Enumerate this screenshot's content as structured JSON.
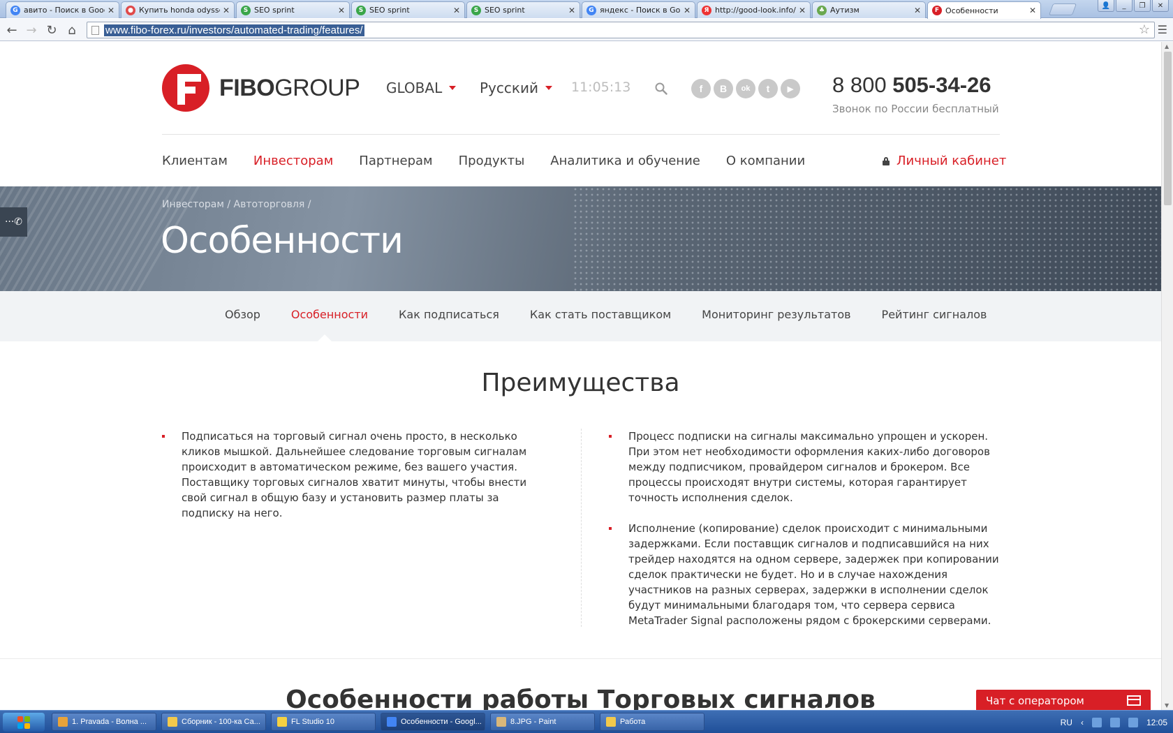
{
  "browser": {
    "tabs": [
      {
        "title": "авито - Поиск в Google",
        "icon": "google-icon",
        "color": "#4285f4",
        "glyph": "G"
      },
      {
        "title": "Купить honda odyssey",
        "icon": "avito-icon",
        "color": "#e04a4a",
        "glyph": "●"
      },
      {
        "title": "SEO sprint",
        "icon": "seosprint-icon",
        "color": "#3aa64a",
        "glyph": "S"
      },
      {
        "title": "SEO sprint",
        "icon": "seosprint-icon",
        "color": "#3aa64a",
        "glyph": "S"
      },
      {
        "title": "SEO sprint",
        "icon": "seosprint-icon",
        "color": "#3aa64a",
        "glyph": "S"
      },
      {
        "title": "яндекс - Поиск в Google",
        "icon": "google-icon",
        "color": "#4285f4",
        "glyph": "G"
      },
      {
        "title": "http://good-look.info/",
        "icon": "yandex-icon",
        "color": "#e33",
        "glyph": "Я"
      },
      {
        "title": "Аутизм",
        "icon": "page-icon",
        "color": "#6aa84f",
        "glyph": "♣"
      },
      {
        "title": "Особенности",
        "icon": "fibo-icon",
        "color": "#d81f26",
        "glyph": "F"
      }
    ],
    "url": "www.fibo-forex.ru/investors/automated-trading/features/"
  },
  "header": {
    "logo_bold": "FIBO",
    "logo_light": "GROUP",
    "region": "GLOBAL",
    "language": "Русский",
    "time": "11:05:13",
    "social": [
      "f",
      "B",
      "ok",
      "t",
      "▶"
    ],
    "phone_prefix": "8 800",
    "phone_main": "505-34-26",
    "phone_note": "Звонок по России бесплатный"
  },
  "nav": {
    "items": [
      "Клиентам",
      "Инвесторам",
      "Партнерам",
      "Продукты",
      "Аналитика и обучение",
      "О компании"
    ],
    "active_index": 1,
    "cabinet": "Личный кабинет"
  },
  "hero": {
    "breadcrumb": "Инвесторам / Автоторговля /",
    "title": "Особенности"
  },
  "subnav": {
    "items": [
      "Обзор",
      "Особенности",
      "Как подписаться",
      "Как стать поставщиком",
      "Мониторинг результатов",
      "Рейтинг сигналов"
    ],
    "active_index": 1
  },
  "advantages": {
    "title": "Преимущества",
    "left": [
      "Подписаться на торговый сигнал очень просто, в несколько кликов мышкой. Дальнейшее следование торговым сигналам происходит в автоматическом режиме, без вашего участия. Поставщику торговых сигналов хватит минуты, чтобы внести свой сигнал в общую базу и установить размер платы за подписку на него."
    ],
    "right": [
      "Процесс подписки на сигналы максимально упрощен и ускорен. При этом нет необходимости оформления каких-либо договоров между подписчиком, провайдером сигналов и брокером. Все процессы происходят внутри системы, которая гарантирует точность исполнения сделок.",
      "Исполнение (копирование) сделок происходит с минимальными задержками. Если поставщик сигналов и подписавшийся на них трейдер находятся на одном сервере, задержек при копировании сделок практически не будет. Но и в случае нахождения участников на разных серверах, задержки в исполнении сделок будут минимальными благодаря том, что сервера сервиса MetaTrader Signal расположены рядом с брокерскими серверами."
    ]
  },
  "section2_title": "Особенности работы Торговых сигналов",
  "chat_label": "Чат с оператором",
  "taskbar": {
    "items": [
      {
        "label": "1. Pravada - Волна ...",
        "color": "#e8a33a"
      },
      {
        "label": "Сборник - 100-ка Са...",
        "color": "#f2c94c"
      },
      {
        "label": "FL Studio 10",
        "color": "#f5d142"
      },
      {
        "label": "Особенности - Googl...",
        "color": "#4285f4"
      },
      {
        "label": "8.JPG - Paint",
        "color": "#d9b77a"
      },
      {
        "label": "Работа",
        "color": "#f2c94c"
      }
    ],
    "active_index": 3,
    "lang": "RU",
    "clock": "12:05"
  },
  "colors": {
    "brand": "#d81f26"
  }
}
